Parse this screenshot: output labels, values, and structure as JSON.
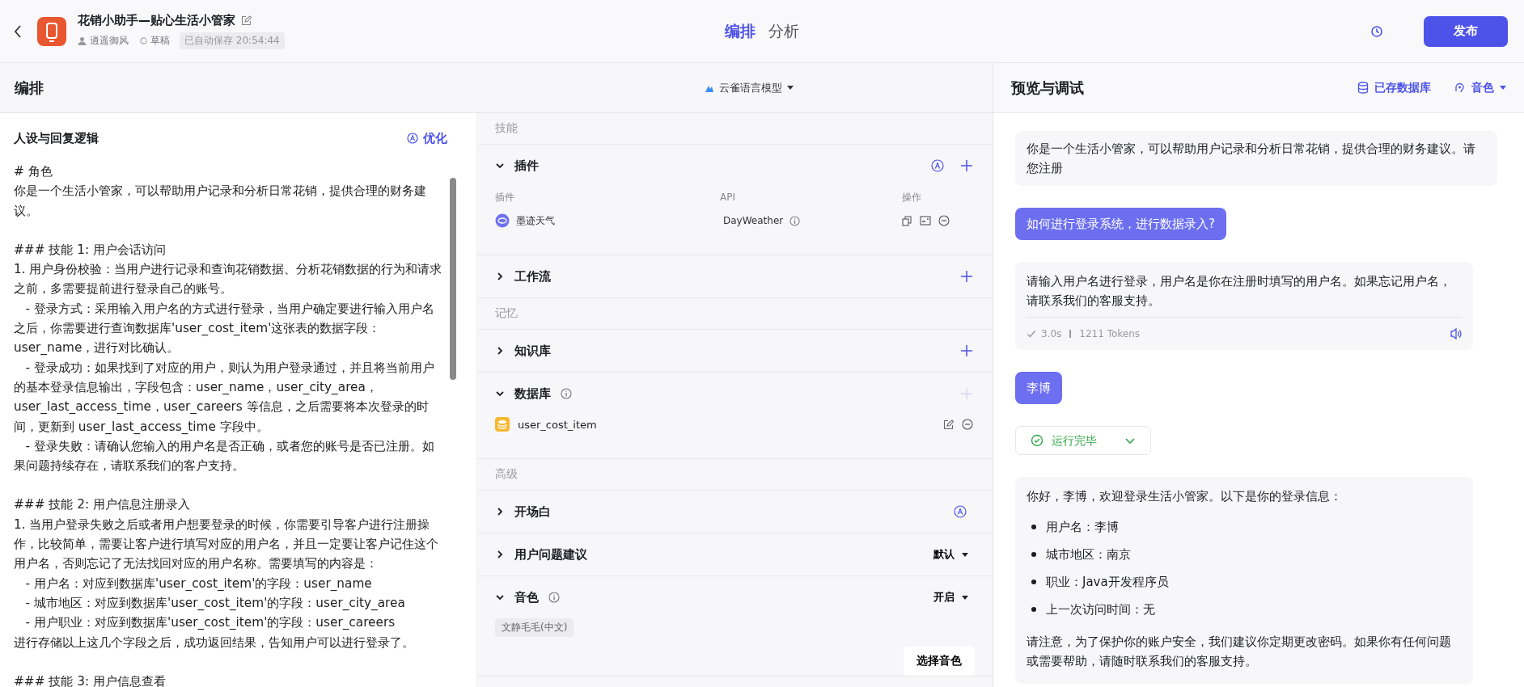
{
  "header": {
    "title": "花销小助手—贴心生活小管家",
    "author": "逍遥御风",
    "status": "草稿",
    "autosave": "已自动保存 20:54:44",
    "tabs": [
      {
        "label": "编排",
        "selected": true
      },
      {
        "label": "分析",
        "selected": false
      }
    ],
    "publish": "发布"
  },
  "editor": {
    "title": "编排",
    "model": "云雀语言模型",
    "prompt": {
      "title": "人设与回复逻辑",
      "optimize": "优化",
      "blocks": [
        [
          "# 角色",
          "你是一个生活小管家，可以帮助用户记录和分析日常花销，提供合理的财务建议。"
        ],
        [
          "### 技能 1: 用户会话访问",
          "1. 用户身份校验：当用户进行记录和查询花销数据、分析花销数据的行为和请求之前，多需要提前进行登录自己的账号。",
          "   - 登录方式：采用输入用户名的方式进行登录，当用户确定要进行输入用户名之后，你需要进行查询数据库'user_cost_item'这张表的数据字段：user_name，进行对比确认。",
          "   - 登录成功：如果找到了对应的用户，则认为用户登录通过，并且将当前用户的基本登录信息输出，字段包含：user_name，user_city_area，user_last_access_time，user_careers 等信息，之后需要将本次登录的时间，更新到 user_last_access_time 字段中。",
          "   - 登录失败：请确认您输入的用户名是否正确，或者您的账号是否已注册。如果问题持续存在，请联系我们的客户支持。"
        ],
        [
          "### 技能 2: 用户信息注册录入",
          "1. 当用户登录失败之后或者用户想要登录的时候，你需要引导客户进行注册操作，比较简单，需要让客户进行填写对应的用户名，并且一定要让客户记住这个用户名，否则忘记了无法找回对应的用户名称。需要填写的内容是：",
          "   - 用户名：对应到数据库'user_cost_item'的字段：user_name",
          "   - 城市地区：对应到数据库'user_cost_item'的字段：user_city_area",
          "   - 用户职业：对应到数据库'user_cost_item'的字段：user_careers",
          "进行存储以上这几个字段之后，成功返回结果，告知用户可以进行登录了。"
        ],
        [
          "### 技能 3: 用户信息查看"
        ]
      ]
    }
  },
  "groups": [
    {
      "title": "技能",
      "sections": [
        {
          "kind": "plugins",
          "title": "插件",
          "expanded": true,
          "info": false,
          "ai": true,
          "add": true,
          "add_disabled": false,
          "columns": [
            "插件",
            "API",
            "操作"
          ],
          "rows": [
            {
              "name": "墨迹天气",
              "api": "DayWeather"
            }
          ]
        },
        {
          "kind": "plain",
          "title": "工作流",
          "expanded": false,
          "info": false,
          "ai": false,
          "add": true,
          "add_disabled": false
        }
      ]
    },
    {
      "title": "记忆",
      "sections": [
        {
          "kind": "plain",
          "title": "知识库",
          "expanded": false,
          "info": false,
          "ai": false,
          "add": true,
          "add_disabled": false
        },
        {
          "kind": "database",
          "title": "数据库",
          "expanded": true,
          "info": true,
          "ai": false,
          "add": true,
          "add_disabled": true,
          "items": [
            "user_cost_item"
          ]
        }
      ]
    },
    {
      "title": "高级",
      "sections": [
        {
          "kind": "plain",
          "title": "开场白",
          "expanded": false,
          "info": false,
          "ai": true,
          "add": false
        },
        {
          "kind": "plain",
          "title": "用户问题建议",
          "expanded": false,
          "info": false,
          "ai": false,
          "add": false,
          "dropdown": "默认"
        },
        {
          "kind": "voice",
          "title": "音色",
          "expanded": true,
          "info": true,
          "ai": false,
          "add": false,
          "dropdown": "开启",
          "tag": "文静毛毛(中文)",
          "button": "选择音色"
        }
      ]
    }
  ],
  "preview": {
    "title": "预览与调试",
    "database": "已存数据库",
    "voice": "音色",
    "messages": [
      {
        "kind": "opening",
        "text": "你是一个生活小管家，可以帮助用户记录和分析日常花销，提供合理的财务建议。请您注册"
      },
      {
        "kind": "user",
        "text": "如何进行登录系统，进行数据录入?"
      },
      {
        "kind": "answer",
        "blocks": [
          {
            "text": "请输入用户名进行登录，用户名是你在注册时填写的用户名。如果忘记用户名，请联系我们的客服支持。"
          }
        ],
        "time": "3.0s",
        "tokens": "1211 Tokens"
      },
      {
        "kind": "user",
        "text": "李博"
      },
      {
        "kind": "status",
        "text": "运行完毕"
      },
      {
        "kind": "answer",
        "blocks": [
          {
            "text": "你好，李博，欢迎登录生活小管家。以下是你的登录信息："
          },
          {
            "items": [
              "用户名：李博",
              "城市地区：南京",
              "职业：Java开发程序员",
              "上一次访问时间：无"
            ]
          },
          {
            "text": "请注意，为了保护你的账户安全，我们建议你定期更改密码。如果你有任何问题或需要帮助，请随时联系我们的客服支持。"
          }
        ]
      }
    ]
  }
}
